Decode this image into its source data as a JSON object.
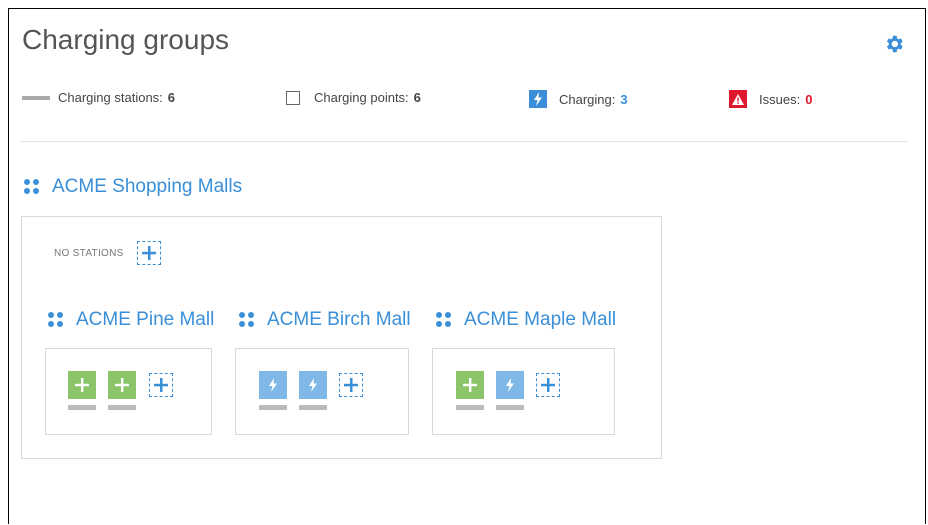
{
  "page": {
    "title": "Charging groups"
  },
  "stats": {
    "stations_label": "Charging stations:",
    "stations_value": "6",
    "points_label": "Charging points:",
    "points_value": "6",
    "charging_label": "Charging:",
    "charging_value": "3",
    "issues_label": "Issues:",
    "issues_value": "0"
  },
  "colors": {
    "accent": "#3a8fd8",
    "issue": "#e0182d",
    "available": "#8cc46a",
    "charging": "#7fb8e6"
  },
  "root_group": {
    "name": "ACME Shopping Malls",
    "no_stations_label": "NO STATIONS"
  },
  "subgroups": [
    {
      "name": "ACME Pine Mall",
      "stations": [
        "available",
        "available"
      ]
    },
    {
      "name": "ACME Birch Mall",
      "stations": [
        "charging",
        "charging"
      ]
    },
    {
      "name": "ACME Maple Mall",
      "stations": [
        "available",
        "charging"
      ]
    }
  ],
  "icons": {
    "settings": "gear-icon",
    "group": "drag-dots-icon",
    "add": "plus-icon",
    "charging": "lightning-icon",
    "issue": "warning-icon"
  }
}
